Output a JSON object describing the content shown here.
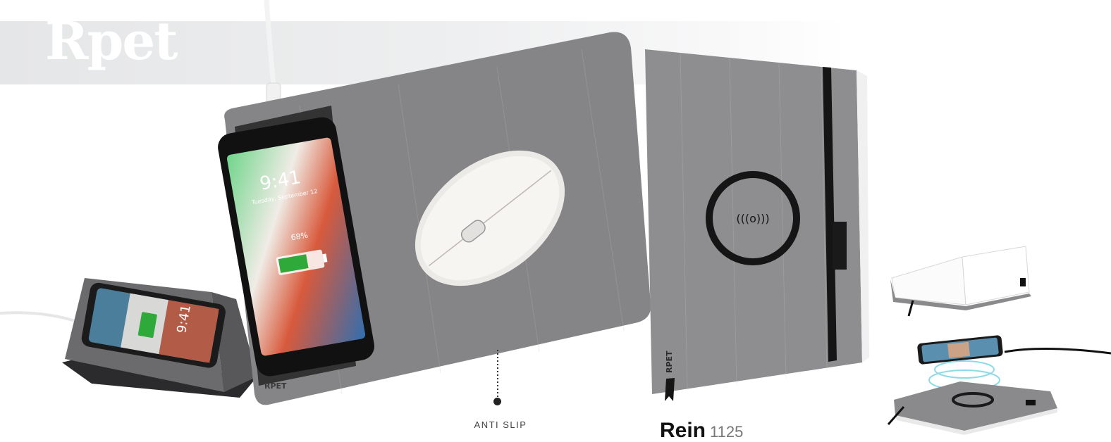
{
  "brand": {
    "title": "Rpet"
  },
  "mousepad": {
    "phone_time": "9:41",
    "phone_date": "Tuesday, September 12",
    "battery_text": "68%",
    "badge": "RPET"
  },
  "stand": {
    "phone_time": "9:41"
  },
  "notebook": {
    "badge": "RPET",
    "wireless_symbol": "(((o)))"
  },
  "callout": {
    "label": "ANTI SLIP"
  },
  "product": {
    "name": "Rein",
    "code": "1125"
  }
}
